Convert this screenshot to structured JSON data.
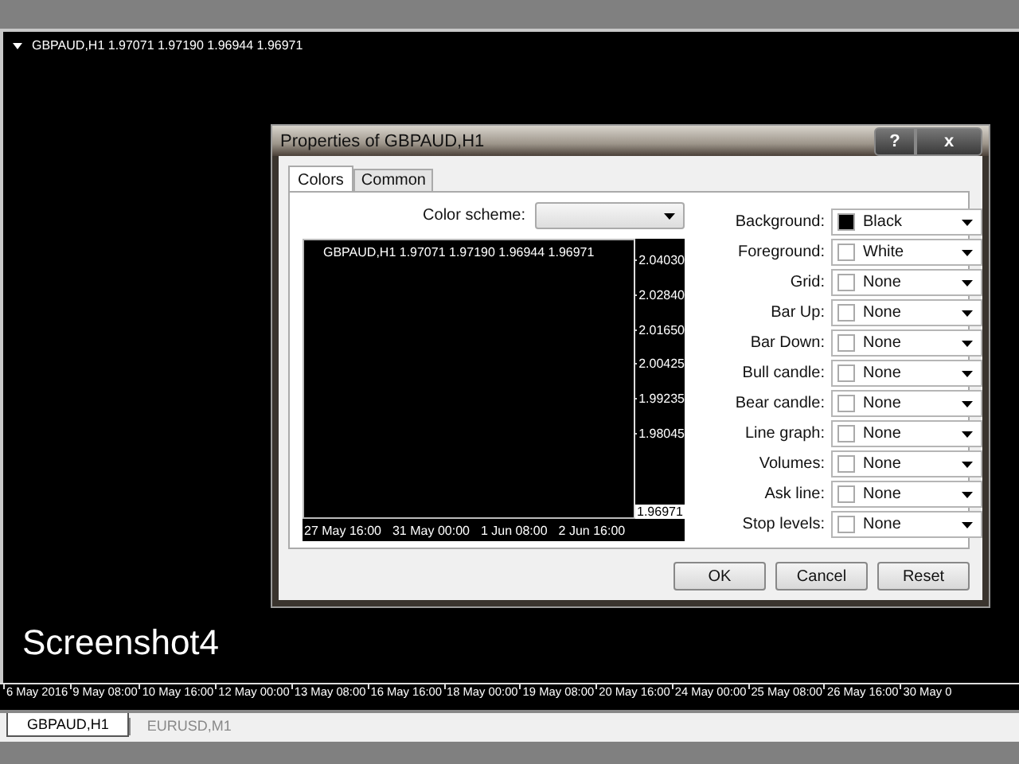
{
  "chart": {
    "header": "GBPAUD,H1  1.97071 1.97190 1.96944 1.96971",
    "caption": "Screenshot4",
    "time_axis": [
      "6 May 2016",
      "9 May 08:00",
      "10 May 16:00",
      "12 May 00:00",
      "13 May 08:00",
      "16 May 16:00",
      "18 May 00:00",
      "19 May 08:00",
      "20 May 16:00",
      "24 May 00:00",
      "25 May 08:00",
      "26 May 16:00",
      "30 May 0"
    ]
  },
  "chart_tabs": [
    {
      "label": "GBPAUD,H1",
      "selected": true
    },
    {
      "label": "EURUSD,M1",
      "selected": false
    }
  ],
  "dialog": {
    "title": "Properties of GBPAUD,H1",
    "help": "?",
    "close": "x",
    "tabs": [
      {
        "label": "Colors",
        "selected": true
      },
      {
        "label": "Common",
        "selected": false
      }
    ],
    "color_scheme": {
      "label": "Color scheme:"
    },
    "preview": {
      "header": "GBPAUD,H1  1.97071 1.97190 1.96944 1.96971",
      "price_axis": [
        "2.04030",
        "2.02840",
        "2.01650",
        "2.00425",
        "1.99235",
        "1.98045"
      ],
      "current_price": "1.96971",
      "time_axis": [
        "27 May 16:00",
        "31 May 00:00",
        "1 Jun 08:00",
        "2 Jun 16:00"
      ]
    },
    "colors": [
      {
        "label": "Background:",
        "value": "Black",
        "color": "#000000"
      },
      {
        "label": "Foreground:",
        "value": "White",
        "color": "#ffffff"
      },
      {
        "label": "Grid:",
        "value": "None",
        "color": "#ffffff"
      },
      {
        "label": "Bar Up:",
        "value": "None",
        "color": "#ffffff"
      },
      {
        "label": "Bar Down:",
        "value": "None",
        "color": "#ffffff"
      },
      {
        "label": "Bull candle:",
        "value": "None",
        "color": "#ffffff"
      },
      {
        "label": "Bear candle:",
        "value": "None",
        "color": "#ffffff"
      },
      {
        "label": "Line graph:",
        "value": "None",
        "color": "#ffffff"
      },
      {
        "label": "Volumes:",
        "value": "None",
        "color": "#ffffff"
      },
      {
        "label": "Ask line:",
        "value": "None",
        "color": "#ffffff"
      },
      {
        "label": "Stop levels:",
        "value": "None",
        "color": "#ffffff"
      }
    ],
    "buttons": [
      "OK",
      "Cancel",
      "Reset"
    ]
  }
}
